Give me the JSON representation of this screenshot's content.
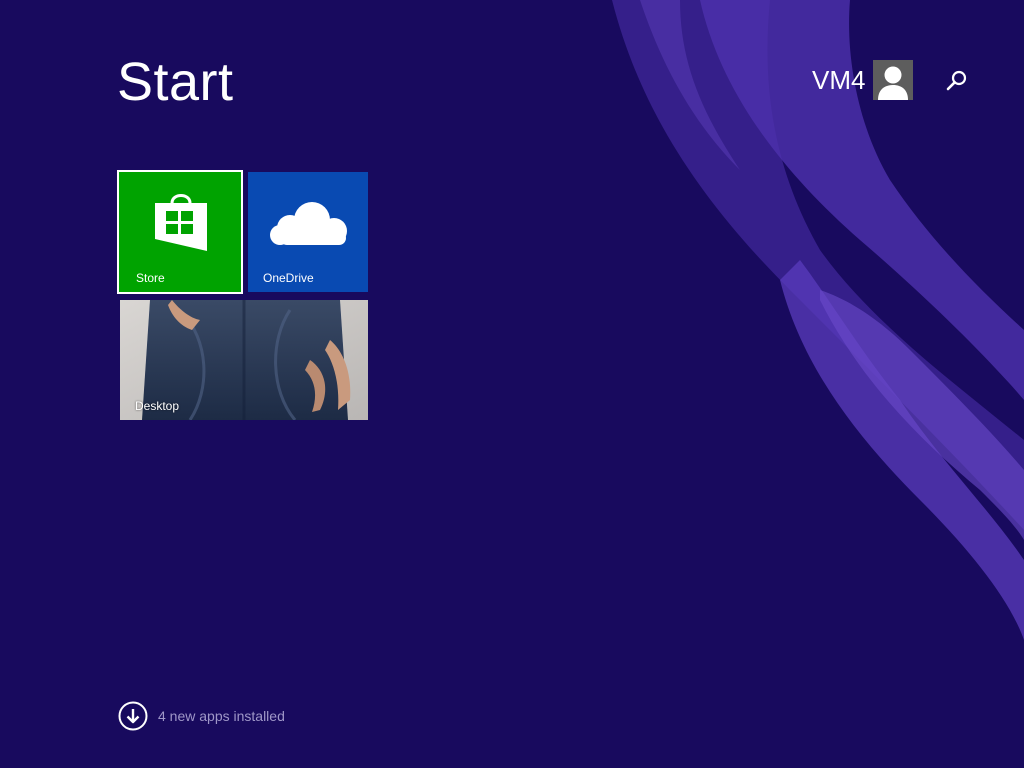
{
  "header": {
    "title": "Start",
    "user_name": "VM4",
    "avatar_icon": "user-silhouette-icon",
    "search_icon": "search-icon"
  },
  "tiles": [
    {
      "label": "Store",
      "color": "#00a300",
      "icon": "store-bag-icon"
    },
    {
      "label": "OneDrive",
      "color": "#094ab2",
      "icon": "cloud-icon"
    },
    {
      "label": "Desktop",
      "color": "#4c5a73",
      "icon": "desktop-wallpaper"
    }
  ],
  "notification": {
    "text": "4 new apps installed",
    "icon": "download-arrow-icon"
  },
  "colors": {
    "background": "#180a5e",
    "accent": "#4a2aa0"
  }
}
